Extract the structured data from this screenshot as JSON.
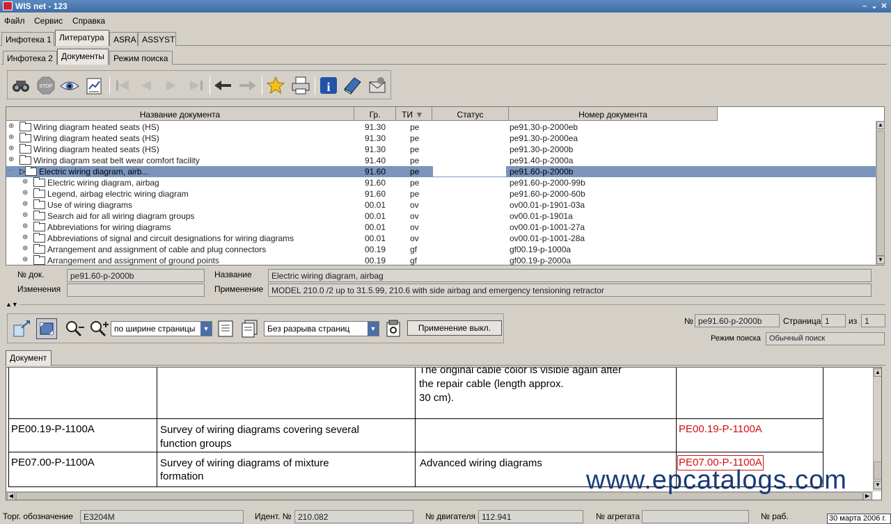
{
  "window": {
    "title": "WIS net - 123",
    "controls": [
      "–",
      "⌄",
      "✕"
    ]
  },
  "menu": [
    "Файл",
    "Сервис",
    "Справка"
  ],
  "main_tabs": [
    "Инфотека 1",
    "Литература",
    "ASRA",
    "ASSYST"
  ],
  "sub_tabs": [
    "Инфотека 2",
    "Документы",
    "Режим поиска"
  ],
  "grid": {
    "columns": [
      "Название документа",
      "Гр.",
      "ТИ",
      "Статус",
      "Номер документа"
    ],
    "rows": [
      {
        "name": "Wiring diagram heated seats (HS)",
        "gr": "91.30",
        "ti": "pe",
        "status": "",
        "num": "pe91.30-p-2000eb"
      },
      {
        "name": "Wiring diagram heated seats (HS)",
        "gr": "91.30",
        "ti": "pe",
        "status": "",
        "num": "pe91.30-p-2000ea"
      },
      {
        "name": "Wiring diagram heated seats (HS)",
        "gr": "91.30",
        "ti": "pe",
        "status": "",
        "num": "pe91.30-p-2000b"
      },
      {
        "name": "Wiring diagram seat belt wear comfort facility",
        "gr": "91.40",
        "ti": "pe",
        "status": "",
        "num": "pe91.40-p-2000a"
      },
      {
        "name": "Electric wiring diagram, airb...",
        "gr": "91.60",
        "ti": "pe",
        "status": "",
        "num": "pe91.60-p-2000b"
      },
      {
        "name": "Electric wiring diagram, airbag",
        "gr": "91.60",
        "ti": "pe",
        "status": "",
        "num": "pe91.60-p-2000-99b"
      },
      {
        "name": "Legend, airbag electric wiring diagram",
        "gr": "91.60",
        "ti": "pe",
        "status": "",
        "num": "pe91.60-p-2000-60b"
      },
      {
        "name": "Use of wiring diagrams",
        "gr": "00.01",
        "ti": "ov",
        "status": "",
        "num": "ov00.01-p-1901-03a"
      },
      {
        "name": "Search aid for all wiring diagram groups",
        "gr": "00.01",
        "ti": "ov",
        "status": "",
        "num": "ov00.01-p-1901a"
      },
      {
        "name": "Abbreviations for wiring diagrams",
        "gr": "00.01",
        "ti": "ov",
        "status": "",
        "num": "ov00.01-p-1001-27a"
      },
      {
        "name": "Abbreviations of signal and circuit designations for wiring diagrams",
        "gr": "00.01",
        "ti": "ov",
        "status": "",
        "num": "ov00.01-p-1001-28a"
      },
      {
        "name": "Arrangement and assignment of cable and plug connectors",
        "gr": "00.19",
        "ti": "gf",
        "status": "",
        "num": "gf00.19-p-1000a"
      },
      {
        "name": "Arrangement and assignment of ground points",
        "gr": "00.19",
        "ti": "gf",
        "status": "",
        "num": "gf00.19-p-2000a"
      }
    ]
  },
  "details": {
    "doc_no_label": "№ док.",
    "doc_no": "pe91.60-p-2000b",
    "changes_label": "Изменения",
    "changes": "",
    "name_label": "Название",
    "name": "Electric wiring diagram, airbag",
    "apply_label": "Применение",
    "apply": "MODEL 210.0 /2 up to 31.5.99, 210.6 with side airbag and emergency tensioning retractor"
  },
  "viewer": {
    "zoom_select": "по ширине страницы",
    "page_break_select": "Без разрыва страниц",
    "apply_button": "Применение выкл.",
    "no_label": "№",
    "no_value": "pe91.60-p-2000b",
    "page_label": "Страница",
    "page": "1",
    "of_label": "из",
    "of_value": "1",
    "search_mode_label": "Режим поиска",
    "search_mode": "Обычный поиск",
    "doc_tab": "Документ"
  },
  "document": {
    "top_text": [
      "The original cable color is visible again after",
      "the repair cable (length approx.",
      "30 cm)."
    ],
    "rows": [
      {
        "code": "PE00.19-P-1100A",
        "desc": [
          "Survey of wiring diagrams covering several",
          "function groups"
        ],
        "note": "",
        "link": "PE00.19-P-1100A"
      },
      {
        "code": "PE07.00-P-1100A",
        "desc": [
          "Survey of wiring diagrams of mixture",
          "formation"
        ],
        "note": "Advanced wiring diagrams",
        "link": "PE07.00-P-1100A"
      }
    ]
  },
  "watermark": "www.epcatalogs.com",
  "status": {
    "trade_label": "Торг. обозначение",
    "trade": "E3204M",
    "ident_label": "Идент. №",
    "ident": "210.082",
    "engine_label": "№ двигателя",
    "engine": "112.941",
    "unit_label": "№ агрегата",
    "unit": "",
    "work_label": "№ раб.",
    "date": "30 марта 2006 г."
  },
  "colors": {
    "selection": "#7b95bc",
    "link_red": "#d01010",
    "title_bar": "#4a78b0"
  }
}
